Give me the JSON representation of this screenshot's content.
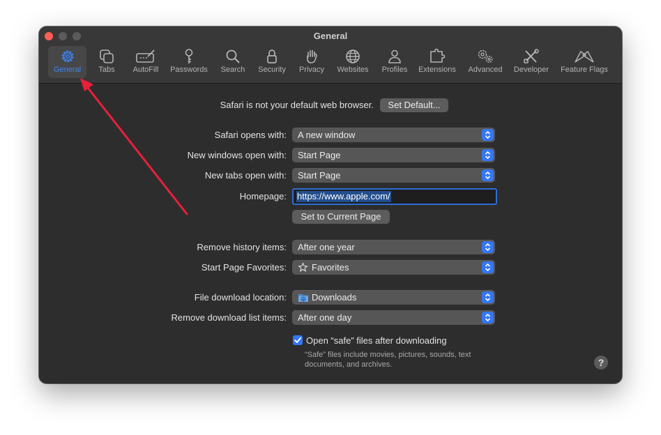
{
  "window": {
    "title": "General"
  },
  "toolbar": {
    "items": [
      {
        "label": "General",
        "icon": "gear-icon"
      },
      {
        "label": "Tabs",
        "icon": "tabs-icon"
      },
      {
        "label": "AutoFill",
        "icon": "autofill-icon"
      },
      {
        "label": "Passwords",
        "icon": "key-icon"
      },
      {
        "label": "Search",
        "icon": "magnifier-icon"
      },
      {
        "label": "Security",
        "icon": "lock-icon"
      },
      {
        "label": "Privacy",
        "icon": "hand-icon"
      },
      {
        "label": "Websites",
        "icon": "globe-icon"
      },
      {
        "label": "Profiles",
        "icon": "person-icon"
      },
      {
        "label": "Extensions",
        "icon": "puzzle-icon"
      },
      {
        "label": "Advanced",
        "icon": "gears-icon"
      },
      {
        "label": "Developer",
        "icon": "tools-icon"
      },
      {
        "label": "Feature Flags",
        "icon": "flags-icon"
      }
    ],
    "selected": "General"
  },
  "default_browser": {
    "message": "Safari is not your default web browser.",
    "button": "Set Default..."
  },
  "settings": {
    "opens_with": {
      "label": "Safari opens with:",
      "value": "A new window"
    },
    "new_windows": {
      "label": "New windows open with:",
      "value": "Start Page"
    },
    "new_tabs": {
      "label": "New tabs open with:",
      "value": "Start Page"
    },
    "homepage": {
      "label": "Homepage:",
      "value": "https://www.apple.com/",
      "button": "Set to Current Page"
    },
    "remove_history": {
      "label": "Remove history items:",
      "value": "After one year"
    },
    "favorites": {
      "label": "Start Page Favorites:",
      "value": "Favorites"
    },
    "download_location": {
      "label": "File download location:",
      "value": "Downloads"
    },
    "remove_downloads": {
      "label": "Remove download list items:",
      "value": "After one day"
    },
    "open_safe": {
      "label": "Open “safe” files after downloading",
      "checked": true,
      "note": "“Safe” files include movies, pictures, sounds, text documents, and archives."
    }
  },
  "help": {
    "label": "?"
  },
  "colors": {
    "accent": "#3477f6",
    "annotation_arrow": "#e8203a",
    "window_bg": "#2d2d2d"
  }
}
